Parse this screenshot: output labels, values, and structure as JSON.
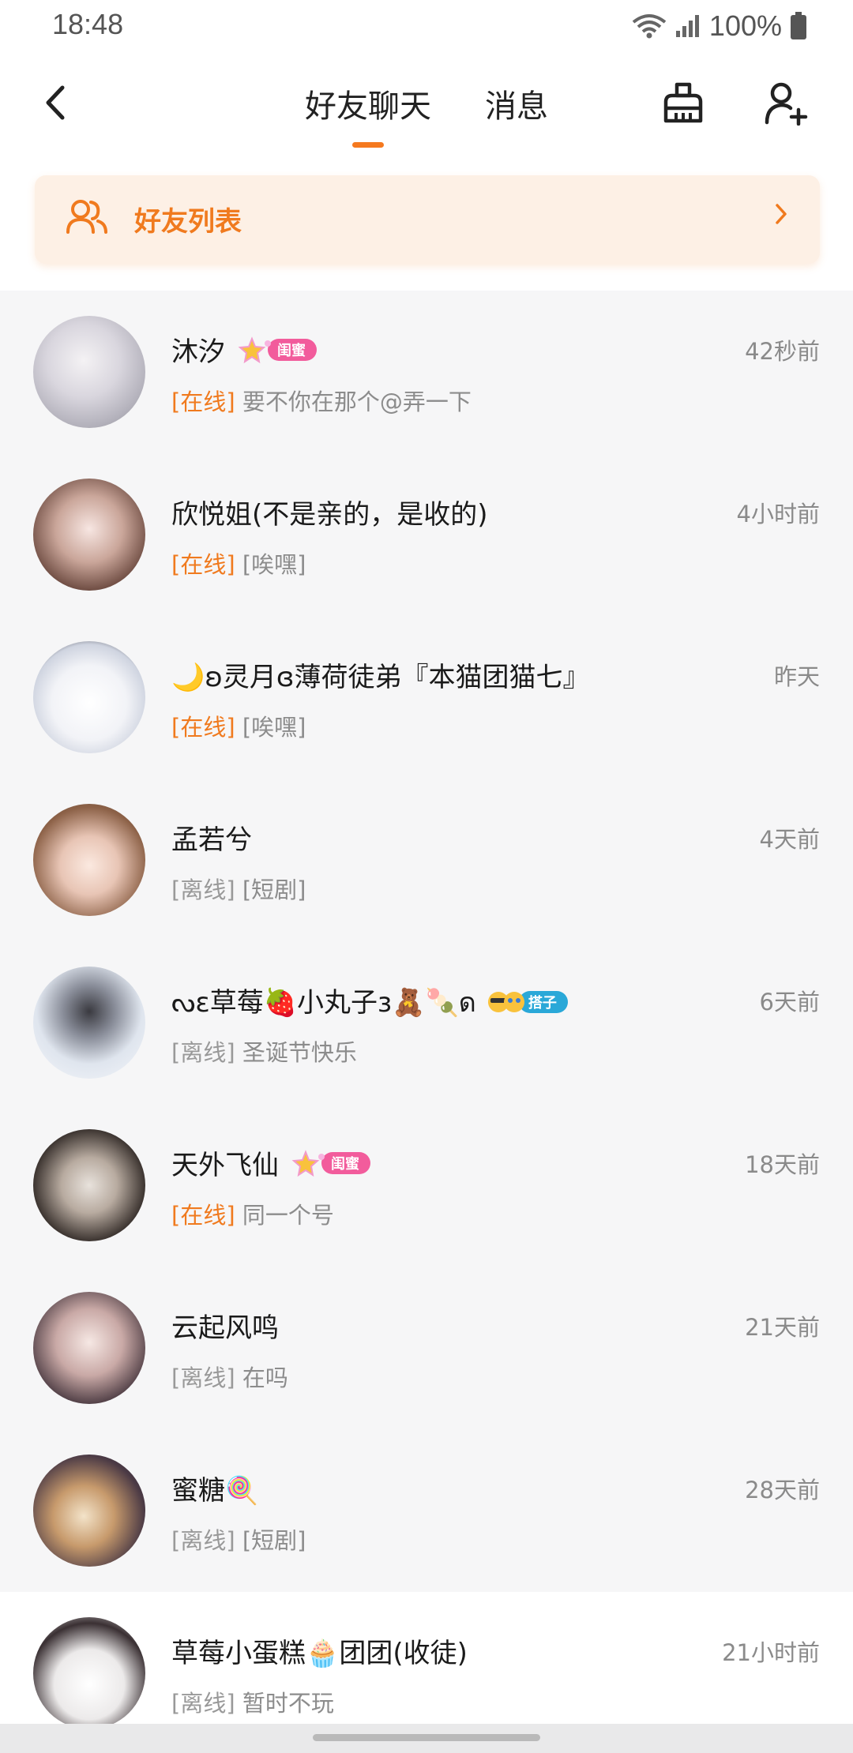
{
  "status_bar": {
    "time": "18:48",
    "battery_pct": "100%"
  },
  "nav": {
    "tabs": [
      {
        "label": "好友聊天",
        "active": true
      },
      {
        "label": "消息",
        "active": false
      }
    ]
  },
  "friend_list_card": {
    "label": "好友列表"
  },
  "colors": {
    "accent": "#f07a1e",
    "indicator": "#f5791f"
  },
  "conversations": [
    {
      "name": "沐汐",
      "badge": "闺蜜",
      "badge_color": "#f25c9c",
      "status": "[在线]",
      "online": true,
      "message": "要不你在那个@弄一下",
      "time": "42秒前"
    },
    {
      "name": "欣悦姐(不是亲的，是收的)",
      "badge": "",
      "status": "[在线]",
      "online": true,
      "message": "[唉嘿]",
      "time": "4小时前"
    },
    {
      "name": "🌙ʚ灵月ɞ薄荷徒弟『本猫团猫七』",
      "badge": "",
      "status": "[在线]",
      "online": true,
      "message": "[唉嘿]",
      "time": "昨天"
    },
    {
      "name": "孟若兮",
      "badge": "",
      "status": "[离线]",
      "online": false,
      "message": "[短剧]",
      "time": "4天前"
    },
    {
      "name": "ᔓɛ草莓🍓小丸子ɜ🧸🍡ด",
      "badge": "搭子",
      "badge_color": "#2aa8d8",
      "status": "[离线]",
      "online": false,
      "message": "圣诞节快乐",
      "time": "6天前"
    },
    {
      "name": "天外飞仙",
      "badge": "闺蜜",
      "badge_color": "#f25c9c",
      "status": "[在线]",
      "online": true,
      "message": "同一个号",
      "time": "18天前"
    },
    {
      "name": "云起风鸣",
      "badge": "",
      "status": "[离线]",
      "online": false,
      "message": "在吗",
      "time": "21天前"
    },
    {
      "name": "蜜糖🍭",
      "badge": "",
      "status": "[离线]",
      "online": false,
      "message": "[短剧]",
      "time": "28天前"
    },
    {
      "name": "草莓小蛋糕🧁团团(收徒)",
      "badge": "",
      "status": "[离线]",
      "online": false,
      "message": "暂时不玩",
      "time": "21小时前"
    }
  ]
}
